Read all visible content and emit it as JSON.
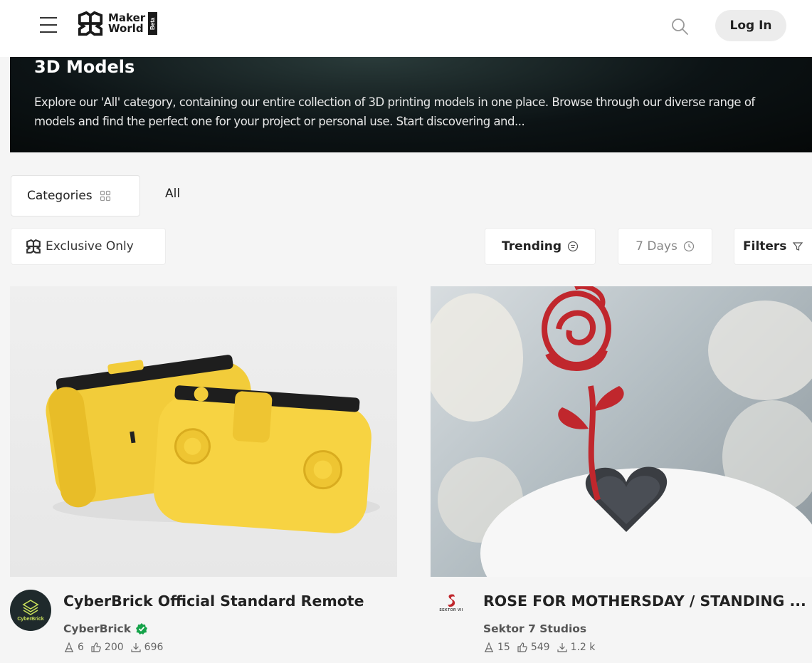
{
  "header": {
    "logo_line1": "Maker",
    "logo_line2": "World",
    "logo_badge": "Beta",
    "login_label": "Log In"
  },
  "banner": {
    "title": "3D Models",
    "description": "Explore our 'All' category, containing our entire collection of 3D printing models in one place. Browse through our diverse range of models and find the perfect one for your project or personal use. Start discovering and..."
  },
  "tabs": {
    "categories_label": "Categories",
    "all_label": "All"
  },
  "filters": {
    "exclusive_label": "Exclusive Only",
    "sort_label": "Trending",
    "period_label": "7 Days",
    "filters_label": "Filters"
  },
  "cards": [
    {
      "title": "CyberBrick Official Standard Remote",
      "author": "CyberBrick",
      "avatar_text": "CyberBrick",
      "verified": true,
      "prints": "6",
      "likes": "200",
      "downloads": "696"
    },
    {
      "title": "ROSE FOR MOTHERSDAY / STANDING ...",
      "author": "Sektor 7 Studios",
      "avatar_text": "SEKTOR VII",
      "verified": false,
      "prints": "15",
      "likes": "549",
      "downloads": "1.2 k"
    }
  ],
  "colors": {
    "accent_green": "#16a34a",
    "banner_bg": "#0c1315",
    "page_bg": "#f5f5f5"
  },
  "icons": [
    "menu-icon",
    "search-icon",
    "grid-icon",
    "exclusive-icon",
    "sort-icon",
    "clock-icon",
    "filter-icon",
    "verified-icon",
    "print-icon",
    "like-icon",
    "download-icon"
  ]
}
